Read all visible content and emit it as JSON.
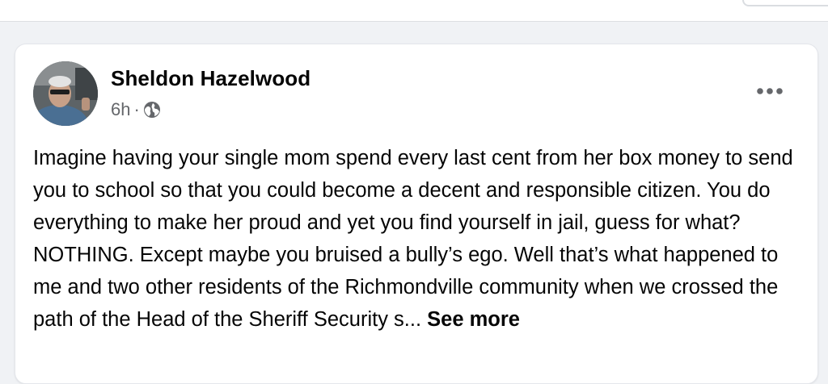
{
  "post": {
    "author": "Sheldon Hazelwood",
    "time": "6h",
    "separator": "·",
    "audience_icon": "globe-icon",
    "menu_icon": "more-horizontal-icon",
    "body": "Imagine having your single mom spend every last cent from her box money to send you to school so that you could become a decent and responsible citizen. You do everything to make her proud and yet you find yourself in jail, guess for what? NOTHING. Except maybe you bruised a bully’s ego. Well that’s what happened to me and two other residents of the Richmondville community when we crossed the path of the Head of the Sheriff Security s...",
    "see_more": "See more"
  },
  "colors": {
    "page_background": "#f0f2f5",
    "card_background": "#ffffff",
    "primary_text": "#050505",
    "secondary_text": "#65676b"
  }
}
